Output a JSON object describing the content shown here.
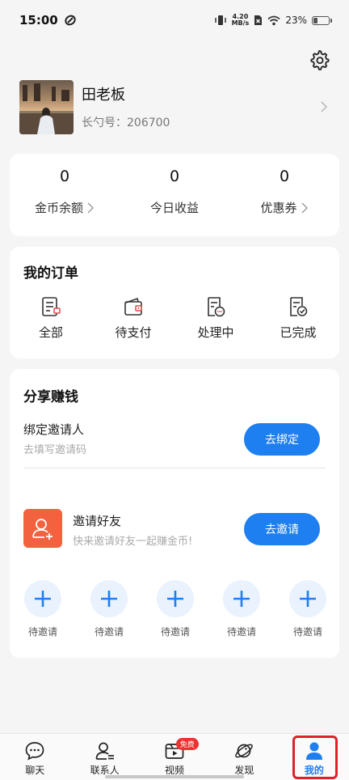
{
  "status_bar": {
    "time": "15:00",
    "net_speed_value": "4.20",
    "net_speed_unit": "MB/s",
    "battery": "23%",
    "battery_level": 0.23
  },
  "profile": {
    "name": "田老板",
    "id_label": "长勺号：206700"
  },
  "stats": [
    {
      "value": "0",
      "label": "金币余额",
      "has_arrow": true
    },
    {
      "value": "0",
      "label": "今日收益",
      "has_arrow": false
    },
    {
      "value": "0",
      "label": "优惠券",
      "has_arrow": true
    }
  ],
  "orders": {
    "title": "我的订单",
    "items": [
      {
        "label": "全部",
        "icon": "order-all-icon"
      },
      {
        "label": "待支付",
        "icon": "wallet-icon"
      },
      {
        "label": "处理中",
        "icon": "processing-icon"
      },
      {
        "label": "已完成",
        "icon": "completed-icon"
      }
    ]
  },
  "share": {
    "title": "分享赚钱",
    "bind": {
      "title": "绑定邀请人",
      "subtitle": "去填写邀请码",
      "button": "去绑定"
    },
    "invite": {
      "title": "邀请好友",
      "subtitle": "快来邀请好友一起赚金币!",
      "button": "去邀请"
    },
    "slots": [
      "待邀请",
      "待邀请",
      "待邀请",
      "待邀请",
      "待邀请"
    ]
  },
  "tabs": [
    {
      "label": "聊天",
      "icon": "chat-icon",
      "active": false
    },
    {
      "label": "联系人",
      "icon": "contacts-icon",
      "active": false
    },
    {
      "label": "视频",
      "icon": "video-icon",
      "active": false,
      "badge": "免费"
    },
    {
      "label": "发现",
      "icon": "planet-icon",
      "active": false
    },
    {
      "label": "我的",
      "icon": "person-icon",
      "active": true
    }
  ],
  "colors": {
    "accent": "#1e7ff0",
    "invite_icon_bg": "#f2623f",
    "badge": "#f23030",
    "highlight_frame": "#e0202a"
  }
}
